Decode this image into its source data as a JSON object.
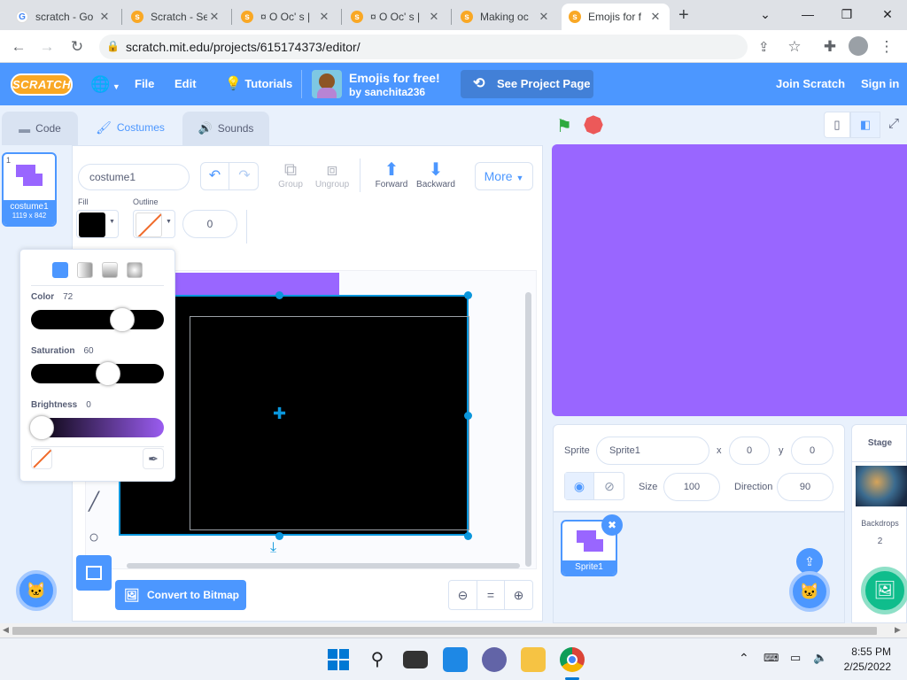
{
  "browser": {
    "tabs": [
      {
        "title": "scratch - Go",
        "icon": "google-icon"
      },
      {
        "title": "Scratch - Se",
        "icon": "scratch-icon"
      },
      {
        "title": "¤ O Oc' s |",
        "icon": "scratch-icon"
      },
      {
        "title": "¤ O Oc' s |",
        "icon": "scratch-icon"
      },
      {
        "title": "Making oc",
        "icon": "scratch-icon"
      },
      {
        "title": "Emojis for f",
        "icon": "scratch-icon"
      }
    ],
    "url": "scratch.mit.edu/projects/615174373/editor/"
  },
  "menubar": {
    "logo": "SCRATCH",
    "file": "File",
    "edit": "Edit",
    "tutorials": "Tutorials",
    "project_title": "Emojis for free!",
    "author": "by sanchita236",
    "see_project": "See Project Page",
    "join": "Join Scratch",
    "signin": "Sign in"
  },
  "editor_tabs": {
    "code": "Code",
    "costumes": "Costumes",
    "sounds": "Sounds"
  },
  "costumes": [
    {
      "index": "1",
      "name": "costume1",
      "size": "1119 x 842"
    }
  ],
  "paint": {
    "costume_name": "costume1",
    "group": "Group",
    "ungroup": "Ungroup",
    "forward": "Forward",
    "backward": "Backward",
    "more": "More",
    "fill_label": "Fill",
    "outline_label": "Outline",
    "outline_width": "0",
    "convert": "Convert to Bitmap",
    "zoom_reset": "="
  },
  "color_picker": {
    "color_label": "Color",
    "color_value": "72",
    "saturation_label": "Saturation",
    "saturation_value": "60",
    "brightness_label": "Brightness",
    "brightness_value": "0"
  },
  "sprite_info": {
    "sprite_label": "Sprite",
    "sprite_name": "Sprite1",
    "x_label": "x",
    "x_value": "0",
    "y_label": "y",
    "y_value": "0",
    "size_label": "Size",
    "size_value": "100",
    "direction_label": "Direction",
    "direction_value": "90"
  },
  "sprites": [
    {
      "name": "Sprite1"
    }
  ],
  "stage_panel": {
    "title": "Stage",
    "backdrops_label": "Backdrops",
    "backdrops_count": "2"
  },
  "taskbar": {
    "time": "8:55 PM",
    "date": "2/25/2022"
  },
  "colors": {
    "scratch_blue": "#4c97ff",
    "stage_purple": "#9966ff",
    "fill_color": "#000000",
    "selection_blue": "#0a96dc"
  }
}
